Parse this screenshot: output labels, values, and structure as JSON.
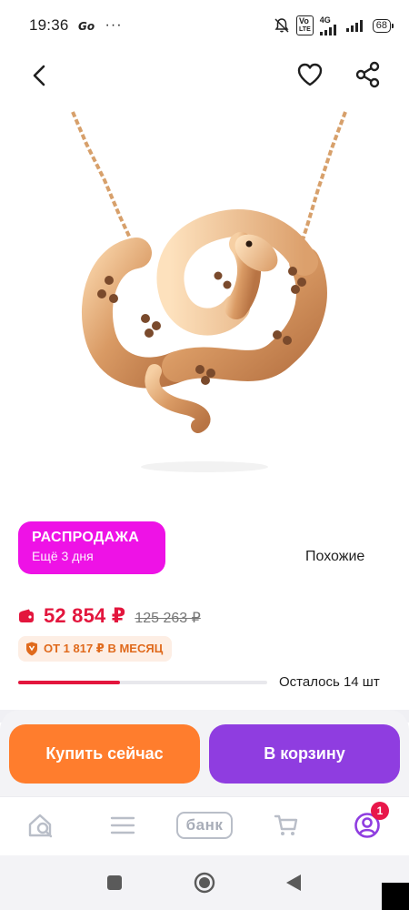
{
  "status_bar": {
    "time": "19:36",
    "carrier_icon": "go-icon",
    "more": "···",
    "network_label_top": "Vo",
    "network_label_bottom": "LTE",
    "signal_label": "4G",
    "battery": "68"
  },
  "top_nav": {
    "back_icon": "chevron-left-icon",
    "favorite_icon": "heart-icon",
    "share_icon": "share-icon"
  },
  "product": {
    "image_alt": "snake pendant necklace",
    "sale": {
      "title": "РАСПРОДАЖА",
      "subtitle": "Ещё 3 дня"
    },
    "similar_label": "Похожие",
    "price": "52 854 ₽",
    "old_price": "125 263 ₽",
    "installment": "ОТ 1 817 ₽ В МЕСЯЦ",
    "stock_text": "Осталось 14 шт",
    "stock_fraction": 0.41
  },
  "actions": {
    "buy_now": "Купить сейчас",
    "add_to_cart": "В корзину"
  },
  "bottom_nav": {
    "home_icon": "home-search-icon",
    "catalog_icon": "menu-icon",
    "bank_label": "банк",
    "cart_icon": "cart-icon",
    "profile_icon": "profile-icon",
    "profile_badge": "1"
  },
  "colors": {
    "sale_badge": "#ee12e6",
    "price": "#e3163d",
    "buy_button": "#ff7d2d",
    "cart_button": "#8f3de0",
    "installment_text": "#e06a1c"
  }
}
